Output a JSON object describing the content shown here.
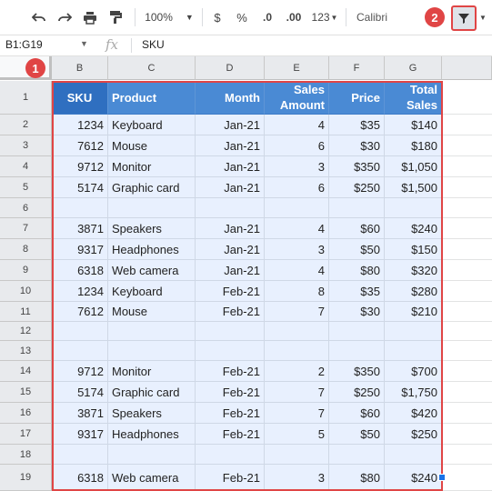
{
  "toolbar": {
    "zoom": "100%",
    "currency": "$",
    "percent": "%",
    "decrease_decimal": ".0",
    "increase_decimal": ".00",
    "more_formats": "123",
    "font": "Calibri"
  },
  "formula_bar": {
    "range": "B1:G19",
    "fx": "fx",
    "value": "SKU"
  },
  "columns": [
    "B",
    "C",
    "D",
    "E",
    "F",
    "G"
  ],
  "rows": [
    "1",
    "2",
    "3",
    "4",
    "5",
    "6",
    "7",
    "8",
    "9",
    "10",
    "11",
    "12",
    "13",
    "14",
    "15",
    "16",
    "17",
    "18",
    "19"
  ],
  "table": {
    "headers": [
      "SKU",
      "Product",
      "Month",
      "Sales Amount",
      "Price",
      "Total Sales"
    ],
    "data": [
      [
        "1234",
        "Keyboard",
        "Jan-21",
        "4",
        "$35",
        "$140"
      ],
      [
        "7612",
        "Mouse",
        "Jan-21",
        "6",
        "$30",
        "$180"
      ],
      [
        "9712",
        "Monitor",
        "Jan-21",
        "3",
        "$350",
        "$1,050"
      ],
      [
        "5174",
        "Graphic card",
        "Jan-21",
        "6",
        "$250",
        "$1,500"
      ],
      [
        "",
        "",
        "",
        "",
        "",
        ""
      ],
      [
        "3871",
        "Speakers",
        "Jan-21",
        "4",
        "$60",
        "$240"
      ],
      [
        "9317",
        "Headphones",
        "Jan-21",
        "3",
        "$50",
        "$150"
      ],
      [
        "6318",
        "Web camera",
        "Jan-21",
        "4",
        "$80",
        "$320"
      ],
      [
        "1234",
        "Keyboard",
        "Feb-21",
        "8",
        "$35",
        "$280"
      ],
      [
        "7612",
        "Mouse",
        "Feb-21",
        "7",
        "$30",
        "$210"
      ],
      [
        "",
        "",
        "",
        "",
        "",
        ""
      ],
      [
        "",
        "",
        "",
        "",
        "",
        ""
      ],
      [
        "9712",
        "Monitor",
        "Feb-21",
        "2",
        "$350",
        "$700"
      ],
      [
        "5174",
        "Graphic card",
        "Feb-21",
        "7",
        "$250",
        "$1,750"
      ],
      [
        "3871",
        "Speakers",
        "Feb-21",
        "7",
        "$60",
        "$420"
      ],
      [
        "9317",
        "Headphones",
        "Feb-21",
        "5",
        "$50",
        "$250"
      ],
      [
        "",
        "",
        "",
        "",
        "",
        ""
      ],
      [
        "6318",
        "Web camera",
        "Feb-21",
        "3",
        "$80",
        "$240"
      ]
    ]
  },
  "annotations": {
    "badge_1": "1",
    "badge_2": "2",
    "color": "#e04545"
  },
  "colors": {
    "header_fill": "#4a8ad4",
    "sku_header_fill": "#2f6fc0",
    "selection_fill": "#e8f0fe"
  }
}
